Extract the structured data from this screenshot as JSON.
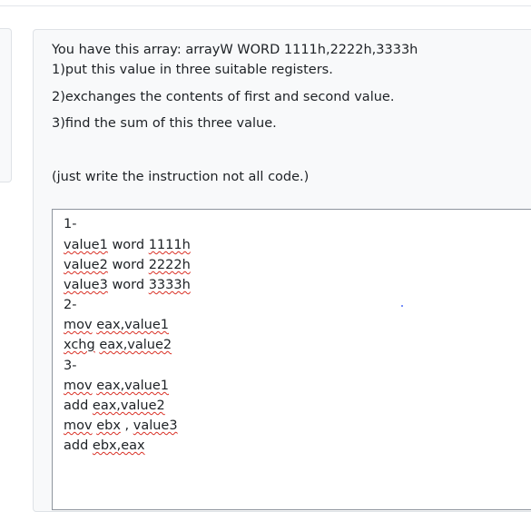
{
  "question": {
    "line1": "You have this array: arrayW WORD 1111h,2222h,3333h",
    "line2": "1)put this value in three suitable registers.",
    "line3": "2)exchanges the contents of first and second value.",
    "line4": "3)find the sum of this three value.",
    "note": "(just write the instruction not all code.)"
  },
  "answer": {
    "l1": "1-",
    "l2a": "value1",
    "l2b": " word ",
    "l2c": "1111h",
    "l3a": "value2",
    "l3b": " word ",
    "l3c": "2222h",
    "l4a": "value3",
    "l4b": " word ",
    "l4c": "3333h",
    "l5": "2-",
    "l6a": "mov",
    "l6b": " ",
    "l6c": "eax,value1",
    "l7a": "xchg",
    "l7b": " ",
    "l7c": "eax,value2",
    "l8": "3-",
    "l9a": "mov",
    "l9b": " ",
    "l9c": "eax,value1",
    "l10a": "add",
    "l10b": " ",
    "l10c": "eax,value2",
    "l11a": "mov",
    "l11b": " ",
    "l11c": "ebx",
    "l11d": " , ",
    "l11e": "value3",
    "l12a": "add",
    "l12b": " ",
    "l12c": "ebx,eax"
  },
  "colors": {
    "spellcheck": "#d93025",
    "card_bg": "#f8f9fa",
    "border": "#dee2e6"
  }
}
